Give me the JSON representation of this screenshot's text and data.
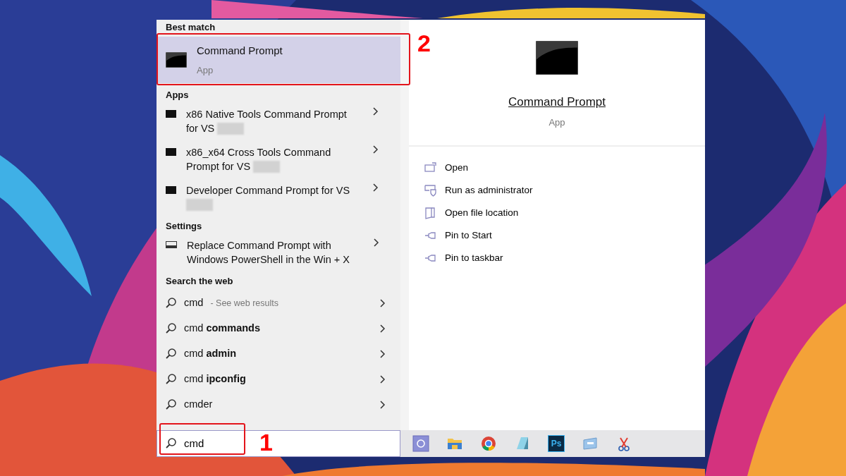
{
  "best_match": {
    "heading": "Best match",
    "title": "Command Prompt",
    "subtitle": "App",
    "selected": true
  },
  "apps": {
    "heading": "Apps",
    "items": [
      {
        "lines": [
          "x86 Native Tools Command Prompt",
          "for VS"
        ],
        "redacted": true
      },
      {
        "lines": [
          "x86_x64 Cross Tools Command",
          "Prompt for VS"
        ],
        "redacted": true
      },
      {
        "lines": [
          "Developer Command Prompt for VS"
        ],
        "redacted": true
      }
    ]
  },
  "settings": {
    "heading": "Settings",
    "items": [
      {
        "text": "Replace Command Prompt with Windows PowerShell in the Win + X"
      }
    ]
  },
  "web": {
    "heading": "Search the web",
    "items": [
      {
        "text": "cmd",
        "hint": "- See web results"
      },
      {
        "text": "cmd **commands**"
      },
      {
        "text": "cmd **admin**"
      },
      {
        "text": "cmd **ipconfig**"
      },
      {
        "text": "cmder"
      }
    ]
  },
  "search": {
    "value": "cmd"
  },
  "detail": {
    "title": "Command Prompt",
    "subtitle": "App",
    "actions": [
      {
        "kind": "open",
        "label": "Open"
      },
      {
        "kind": "admin",
        "label": "Run as administrator"
      },
      {
        "kind": "location",
        "label": "Open file location"
      },
      {
        "kind": "pin",
        "label": "Pin to Start"
      },
      {
        "kind": "pin",
        "label": "Pin to taskbar"
      }
    ]
  },
  "taskbar": [
    {
      "kind": "app"
    },
    {
      "kind": "folder"
    },
    {
      "kind": "browser"
    },
    {
      "kind": "notepad"
    },
    {
      "kind": "ps",
      "label": "Ps"
    },
    {
      "kind": "window"
    },
    {
      "kind": "snip"
    }
  ],
  "annotations": [
    {
      "label": "2"
    },
    {
      "label": "1"
    }
  ]
}
